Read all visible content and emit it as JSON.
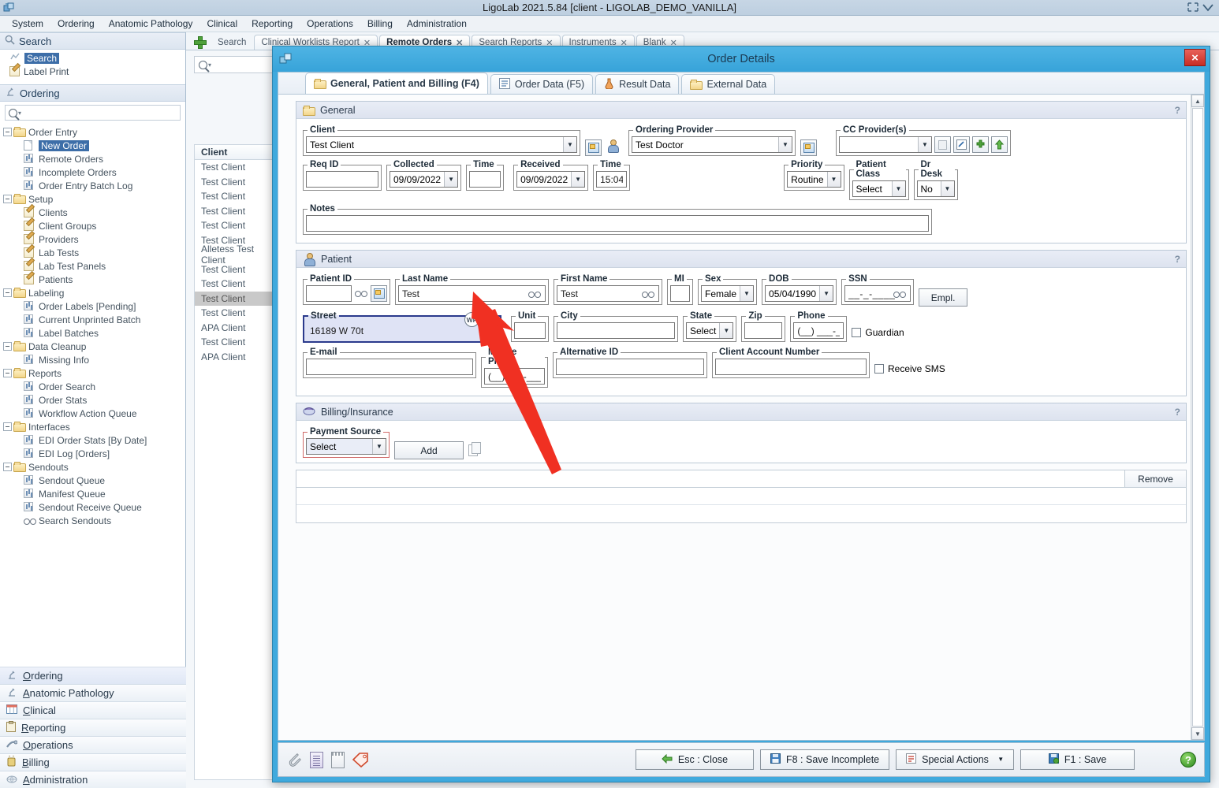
{
  "window": {
    "title": "LigoLab 2021.5.84 [client - LIGOLAB_DEMO_VANILLA]",
    "app_icon": "ligolab-icon"
  },
  "menubar": {
    "items": [
      "System",
      "Ordering",
      "Anatomic Pathology",
      "Clinical",
      "Reporting",
      "Operations",
      "Billing",
      "Administration"
    ]
  },
  "sidebar": {
    "search_panel": {
      "title": "Search",
      "items": [
        {
          "label": "Search",
          "icon": "search-icon",
          "selected": true
        },
        {
          "label": "Label Print",
          "icon": "label-print-icon",
          "selected": false
        }
      ]
    },
    "ordering_panel": {
      "title": "Ordering",
      "search_placeholder": "",
      "tree": [
        {
          "label": "Order Entry",
          "type": "folder",
          "level": 0
        },
        {
          "label": "New Order",
          "type": "doc",
          "level": 1,
          "selected": true
        },
        {
          "label": "Remote Orders",
          "type": "report",
          "level": 1
        },
        {
          "label": "Incomplete Orders",
          "type": "report",
          "level": 1
        },
        {
          "label": "Order Entry Batch Log",
          "type": "report",
          "level": 1
        },
        {
          "label": "Setup",
          "type": "folder",
          "level": 0
        },
        {
          "label": "Clients",
          "type": "pen",
          "level": 1
        },
        {
          "label": "Client Groups",
          "type": "pen",
          "level": 1
        },
        {
          "label": "Providers",
          "type": "pen",
          "level": 1
        },
        {
          "label": "Lab Tests",
          "type": "pen",
          "level": 1
        },
        {
          "label": "Lab Test Panels",
          "type": "pen",
          "level": 1
        },
        {
          "label": "Patients",
          "type": "pen",
          "level": 1
        },
        {
          "label": "Labeling",
          "type": "folder",
          "level": 0
        },
        {
          "label": "Order Labels [Pending]",
          "type": "report",
          "level": 1
        },
        {
          "label": "Current Unprinted Batch",
          "type": "report",
          "level": 1
        },
        {
          "label": "Label Batches",
          "type": "report",
          "level": 1
        },
        {
          "label": "Data Cleanup",
          "type": "folder",
          "level": 0
        },
        {
          "label": "Missing Info",
          "type": "report",
          "level": 1
        },
        {
          "label": "Reports",
          "type": "folder",
          "level": 0
        },
        {
          "label": "Order Search",
          "type": "report",
          "level": 1
        },
        {
          "label": "Order Stats",
          "type": "report",
          "level": 1
        },
        {
          "label": "Workflow Action Queue",
          "type": "report",
          "level": 1
        },
        {
          "label": "Interfaces",
          "type": "folder",
          "level": 0
        },
        {
          "label": "EDI Order Stats [By Date]",
          "type": "report",
          "level": 1
        },
        {
          "label": "EDI Log [Orders]",
          "type": "report",
          "level": 1
        },
        {
          "label": "Sendouts",
          "type": "folder",
          "level": 0
        },
        {
          "label": "Sendout Queue",
          "type": "report",
          "level": 1
        },
        {
          "label": "Manifest Queue",
          "type": "report",
          "level": 1
        },
        {
          "label": "Sendout Receive Queue",
          "type": "report",
          "level": 1
        },
        {
          "label": "Search Sendouts",
          "type": "glasses",
          "level": 1
        }
      ]
    },
    "modules": [
      {
        "label": "Ordering",
        "icon": "microscope-icon",
        "active": true
      },
      {
        "label": "Anatomic Pathology",
        "icon": "microscope-icon",
        "active": false
      },
      {
        "label": "Clinical",
        "icon": "grid-icon",
        "active": false
      },
      {
        "label": "Reporting",
        "icon": "clipboard-icon",
        "active": false
      },
      {
        "label": "Operations",
        "icon": "gear-icon",
        "active": false
      },
      {
        "label": "Billing",
        "icon": "money-icon",
        "active": false
      },
      {
        "label": "Administration",
        "icon": "globe-icon",
        "active": false
      }
    ]
  },
  "workspace": {
    "tabs": [
      {
        "label": "Search",
        "closable": false,
        "active": false
      },
      {
        "label": "Clinical Worklists Report",
        "closable": true,
        "active": false
      },
      {
        "label": "Remote Orders",
        "closable": true,
        "active": true
      },
      {
        "label": "Search Reports",
        "closable": true,
        "active": false
      },
      {
        "label": "Instruments",
        "closable": true,
        "active": false
      },
      {
        "label": "Blank",
        "closable": true,
        "active": false
      }
    ],
    "search_value": "",
    "grid": {
      "header": "Client",
      "rows": [
        {
          "name": "Test Client",
          "selected": false
        },
        {
          "name": "Test Client",
          "selected": false
        },
        {
          "name": "Test Client",
          "selected": false
        },
        {
          "name": "Test Client",
          "selected": false
        },
        {
          "name": "Test Client",
          "selected": false
        },
        {
          "name": "Test Client",
          "selected": false
        },
        {
          "name": "Alletess Test Client",
          "selected": false
        },
        {
          "name": "Test Client",
          "selected": false
        },
        {
          "name": "Test Client",
          "selected": false
        },
        {
          "name": "Test Client",
          "selected": true
        },
        {
          "name": "Test Client",
          "selected": false
        },
        {
          "name": "APA Client",
          "selected": false
        },
        {
          "name": "Test Client",
          "selected": false
        },
        {
          "name": "APA Client",
          "selected": false
        }
      ]
    }
  },
  "dialog": {
    "title": "Order Details",
    "close_label": "×",
    "tabs": [
      {
        "label": "General, Patient and Billing (F4)",
        "icon": "folder-icon",
        "active": true
      },
      {
        "label": "Order Data (F5)",
        "icon": "list-icon",
        "active": false
      },
      {
        "label": "Result Data",
        "icon": "flask-icon",
        "active": false
      },
      {
        "label": "External Data",
        "icon": "folder-icon",
        "active": false
      }
    ],
    "general": {
      "title": "General",
      "help_marker": "?",
      "client": {
        "label": "Client",
        "value": "Test Client"
      },
      "ordering_provider": {
        "label": "Ordering Provider",
        "value": "Test Doctor"
      },
      "cc_providers": {
        "label": "CC Provider(s)",
        "value": ""
      },
      "req_id": {
        "label": "Req ID",
        "value": ""
      },
      "collected": {
        "label": "Collected",
        "value": "09/09/2022"
      },
      "collected_time": {
        "label": "Time",
        "value": ""
      },
      "received": {
        "label": "Received",
        "value": "09/09/2022"
      },
      "received_time": {
        "label": "Time",
        "value": "15:04"
      },
      "priority": {
        "label": "Priority",
        "value": "Routine"
      },
      "patient_class": {
        "label": "Patient Class",
        "value": "Select"
      },
      "dr_desk": {
        "label": "Dr Desk",
        "value": "No"
      },
      "notes": {
        "label": "Notes",
        "value": ""
      }
    },
    "patient": {
      "title": "Patient",
      "help_marker": "?",
      "patient_id": {
        "label": "Patient ID",
        "value": ""
      },
      "last_name": {
        "label": "Last Name",
        "value": "Test"
      },
      "first_name": {
        "label": "First Name",
        "value": "Test"
      },
      "mi": {
        "label": "MI",
        "value": ""
      },
      "sex": {
        "label": "Sex",
        "value": "Female"
      },
      "dob": {
        "label": "DOB",
        "value": "05/04/1990"
      },
      "ssn": {
        "label": "SSN",
        "value": "__-_-____"
      },
      "empl_button": "Empl.",
      "street": {
        "label": "Street",
        "value": "16189 W 70t",
        "badge": "WP",
        "info_icon": "info-icon"
      },
      "unit": {
        "label": "Unit",
        "value": ""
      },
      "city": {
        "label": "City",
        "value": ""
      },
      "state": {
        "label": "State",
        "value": "Select"
      },
      "zip": {
        "label": "Zip",
        "value": ""
      },
      "phone": {
        "label": "Phone",
        "value": "(__) ___-____"
      },
      "guardian": {
        "label": "Guardian",
        "checked": false
      },
      "email": {
        "label": "E-mail",
        "value": ""
      },
      "mobile_phone": {
        "label": "Mobile Phone",
        "value": "(__) ___-____"
      },
      "alternative_id": {
        "label": "Alternative ID",
        "value": ""
      },
      "client_account_number": {
        "label": "Client Account Number",
        "value": ""
      },
      "receive_sms": {
        "label": "Receive SMS",
        "checked": false
      }
    },
    "billing": {
      "title": "Billing/Insurance",
      "help_marker": "?",
      "payment_source": {
        "label": "Payment Source",
        "value": "Select"
      },
      "add_button": "Add",
      "copy_button_icon": "copy-icon",
      "remove_header": "Remove"
    },
    "footer": {
      "icons": [
        "attachment-icon",
        "notes-icon",
        "notepad-icon",
        "tag-icon"
      ],
      "buttons": [
        {
          "label": "Esc : Close",
          "icon": "back-arrow-icon",
          "type": "button"
        },
        {
          "label": "F8 : Save Incomplete",
          "icon": "save-icon",
          "type": "button"
        },
        {
          "label": "Special Actions",
          "icon": "actions-icon",
          "type": "dropdown"
        },
        {
          "label": "F1 : Save",
          "icon": "save-ok-icon",
          "type": "button"
        }
      ],
      "help_icon": "help-icon"
    }
  },
  "annotation": {
    "arrow_color": "#f03022",
    "points_to": "street-field-info-icon"
  }
}
